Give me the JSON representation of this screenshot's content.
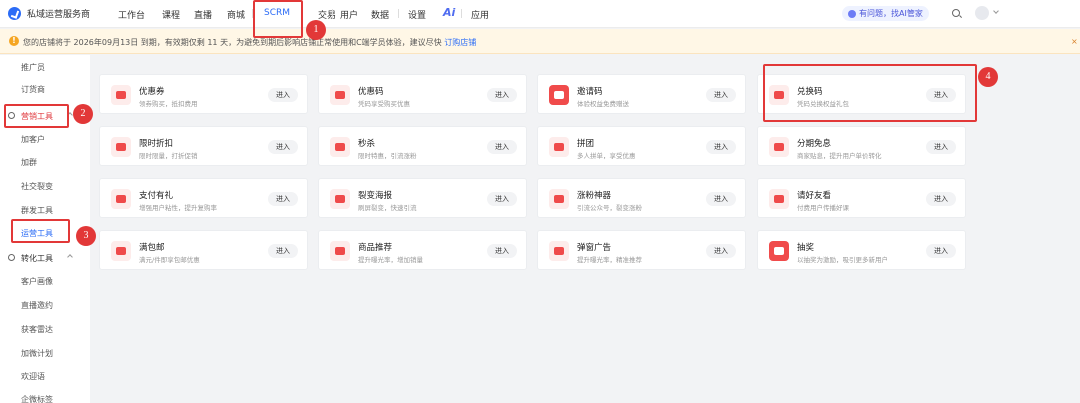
{
  "header": {
    "brand": "私域运营服务商",
    "nav": [
      "工作台",
      "课程",
      "直播",
      "商城",
      "SCRM",
      "交易",
      "用户",
      "数据",
      "设置",
      "Ai",
      "应用"
    ],
    "active_nav": "SCRM",
    "help": "有问题，找AI管家"
  },
  "notice": {
    "text": "您的店铺将于 2026年09月13日 到期，有效期仅剩 11 天，为避免到期后影响店铺正常使用和C端学员体验，建议尽快",
    "link": "订购店铺",
    "close": "×"
  },
  "sidebar": {
    "items": [
      {
        "label": "推广员"
      },
      {
        "label": "订货商"
      },
      {
        "label": "营销工具",
        "group": true,
        "active": true
      },
      {
        "label": "加客户"
      },
      {
        "label": "加群"
      },
      {
        "label": "社交裂变"
      },
      {
        "label": "群发工具"
      },
      {
        "label": "运营工具",
        "active": true
      },
      {
        "label": "转化工具",
        "group": true
      },
      {
        "label": "客户画像"
      },
      {
        "label": "直播邀约"
      },
      {
        "label": "获客雷达"
      },
      {
        "label": "加微计划"
      },
      {
        "label": "欢迎语"
      },
      {
        "label": "企微标签"
      }
    ]
  },
  "tools": [
    {
      "title": "优惠券",
      "desc": "领券购买，抵扣费用",
      "button": "进入"
    },
    {
      "title": "优惠码",
      "desc": "凭码享受购买优惠",
      "button": "进入"
    },
    {
      "title": "邀请码",
      "desc": "体验权益免费赠送",
      "button": "进入"
    },
    {
      "title": "兑换码",
      "desc": "凭码兑换权益礼包",
      "button": "进入"
    },
    {
      "title": "限时折扣",
      "desc": "限时限量，打折促销",
      "button": "进入"
    },
    {
      "title": "秒杀",
      "desc": "限时特惠，引流涨粉",
      "button": "进入"
    },
    {
      "title": "拼团",
      "desc": "多人拼单，享受优惠",
      "button": "进入"
    },
    {
      "title": "分期免息",
      "desc": "商家贴息，提升用户单价转化",
      "button": "进入"
    },
    {
      "title": "支付有礼",
      "desc": "增强用户粘性，提升复购率",
      "button": "进入"
    },
    {
      "title": "裂变海报",
      "desc": "刷屏裂变，快速引流",
      "button": "进入"
    },
    {
      "title": "涨粉神器",
      "desc": "引流公众号，裂变涨粉",
      "button": "进入"
    },
    {
      "title": "请好友看",
      "desc": "付费用户传播好课",
      "button": "进入"
    },
    {
      "title": "满包邮",
      "desc": "满元/件即享包邮优惠",
      "button": "进入"
    },
    {
      "title": "商品推荐",
      "desc": "提升曝光率，增加销量",
      "button": "进入"
    },
    {
      "title": "弹窗广告",
      "desc": "提升曝光率，精准推荐",
      "button": "进入"
    },
    {
      "title": "抽奖",
      "desc": "以抽奖为激励，吸引更多新用户",
      "button": "进入"
    }
  ],
  "annotations": [
    "1",
    "2",
    "3",
    "4"
  ],
  "colors": {
    "accent": "#2b6cf6",
    "annotation": "#e23838",
    "tool_icon": "#ef4a4a"
  }
}
